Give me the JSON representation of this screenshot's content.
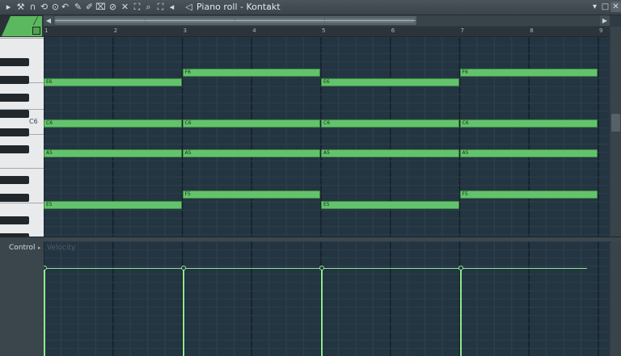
{
  "window": {
    "title": "Piano roll - Kontakt",
    "title_arrow": "›",
    "menu_arrow": "▸",
    "controls": {
      "minimize": "▾",
      "maximize": "□",
      "close": "✕"
    }
  },
  "toolbar": {
    "icons": [
      "menu-arrow-icon",
      "wrench-icon",
      "magnet-icon",
      "loop-icon",
      "record-icon",
      "undo-icon",
      "pencil-icon",
      "brush-icon",
      "delete-tool-icon",
      "mute-tool-icon",
      "speaker-icon",
      "select-tool-icon",
      "zoom-icon",
      "zoom-frame-icon",
      "playback-icon",
      "speaker-nav-icon"
    ]
  },
  "ruler": {
    "bars": [
      "1",
      "2",
      "3",
      "4",
      "5",
      "6",
      "7",
      "8",
      "9"
    ]
  },
  "keyboard": {
    "c6_label": "C6"
  },
  "notes": [
    {
      "name": "E6",
      "start": 1,
      "end": 3
    },
    {
      "name": "E6",
      "start": 5,
      "end": 7
    },
    {
      "name": "F6",
      "start": 3,
      "end": 5
    },
    {
      "name": "F6",
      "start": 7,
      "end": 9
    },
    {
      "name": "C6",
      "start": 1,
      "end": 3
    },
    {
      "name": "C6",
      "start": 3,
      "end": 5
    },
    {
      "name": "C6",
      "start": 5,
      "end": 7
    },
    {
      "name": "C6",
      "start": 7,
      "end": 9
    },
    {
      "name": "A5",
      "start": 1,
      "end": 3
    },
    {
      "name": "A5",
      "start": 3,
      "end": 5
    },
    {
      "name": "A5",
      "start": 5,
      "end": 7
    },
    {
      "name": "A5",
      "start": 7,
      "end": 9
    },
    {
      "name": "F5",
      "start": 3,
      "end": 5
    },
    {
      "name": "F5",
      "start": 7,
      "end": 9
    },
    {
      "name": "E5",
      "start": 1,
      "end": 3
    },
    {
      "name": "E5",
      "start": 5,
      "end": 7
    }
  ],
  "control": {
    "label": "Control",
    "arrow": "▸",
    "parameter": "Velocity",
    "events": [
      1,
      3,
      5,
      7
    ]
  },
  "colors": {
    "note": "#63c36c",
    "grid_bg": "#243542",
    "velocity": "#8ee890"
  }
}
